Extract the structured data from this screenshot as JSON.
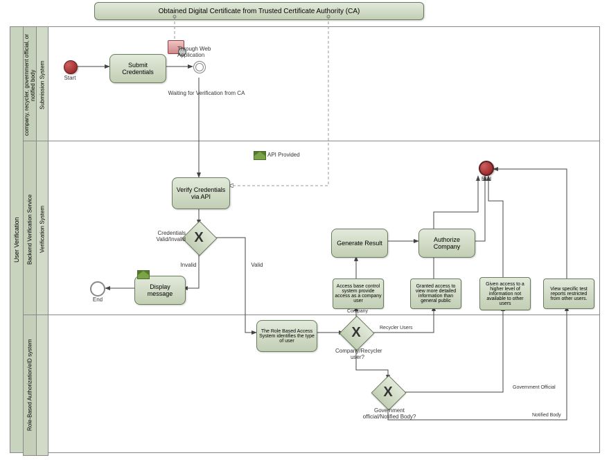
{
  "title_bar": "Obtained Digital Certificate from Trusted Certificate Authority (CA)",
  "pool": {
    "label": "User Verification",
    "lanes": [
      {
        "label": "company, recycler, government official, or notified body",
        "sub": "Submission System"
      },
      {
        "label": "Backend Verification Service",
        "sub": "Verification System"
      },
      {
        "label": "Role-Based Authorization/eID system",
        "sub": ""
      }
    ]
  },
  "events": {
    "start": "Start",
    "end1": "End",
    "end2": "End",
    "waiting": "Waiting for Verification from CA",
    "through_web": "Through Web Application",
    "api_provided": "API Provided"
  },
  "tasks": {
    "submit": "Submit Credentials",
    "verify": "Verify Credentials via API",
    "display": "Display message",
    "generate": "Generate Result",
    "authorize": "Authorize Company",
    "identify": "The Role Based Access System identifies the type of user"
  },
  "gateways": {
    "g1_label": "Credentials Valid/Invalid",
    "g1_invalid": "Invalid",
    "g1_valid": "Valid",
    "g2_label": "Company/Recycler user?",
    "g2_company": "Company",
    "g2_recycler": "Recycler Users",
    "g3_label": "Government official/Notified Body?",
    "g3_gov": "Government Official",
    "g3_nb": "Notified Body"
  },
  "notes": {
    "n_access": "Access base control system provide access as a company user",
    "n_granted": "Granted access to view more detailed information than general public",
    "n_higher": "Given access to a higher level of information not available to other users",
    "n_reports": "View specific test reports restricted from other users."
  }
}
